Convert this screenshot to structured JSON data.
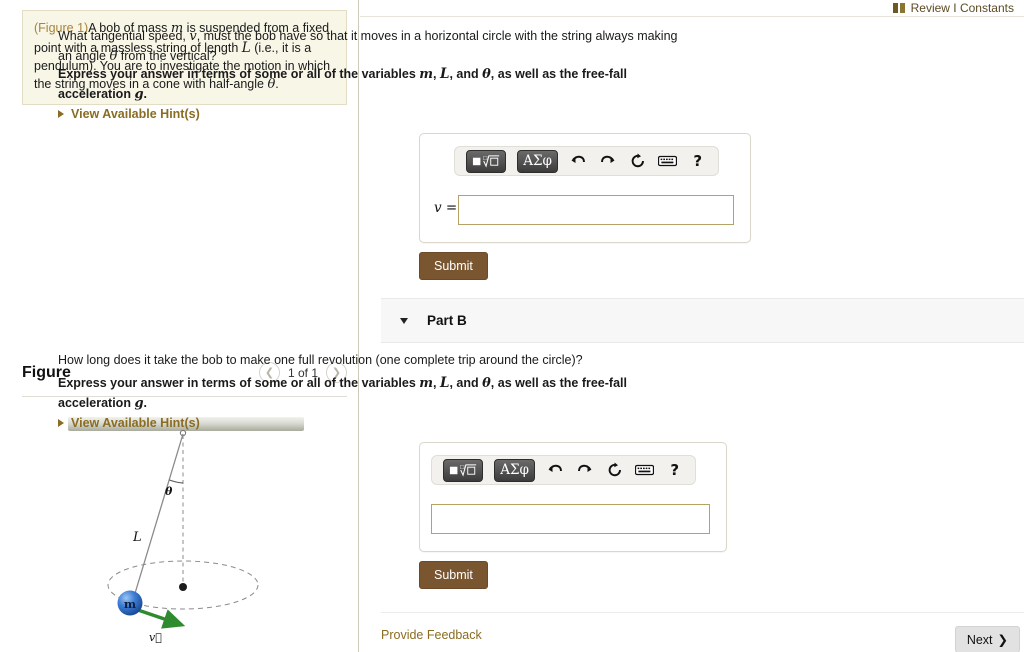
{
  "review": {
    "label": "Review I Constants",
    "icon": "book-icon"
  },
  "problem": {
    "figure_ref": "(Figure 1)",
    "text_1": "A bob of mass ",
    "var_m": "m",
    "text_2": " is suspended from a fixed point with a massless string of length ",
    "var_L": "L",
    "text_3": " (i.e., it is a pendulum). You are to investigate the motion in which the string moves in a cone with half-angle ",
    "var_theta": "θ",
    "text_4": "."
  },
  "figure_panel": {
    "title": "Figure",
    "prev_icon": "chevron-left-icon",
    "next_icon": "chevron-right-icon",
    "count": "1 of 1",
    "labels": {
      "mass": "m",
      "length": "L",
      "angle": "θ",
      "velocity": "v"
    }
  },
  "part_a": {
    "question": "What tangential speed, ",
    "question_var": "v",
    "question_cont": ", must the bob have so that it moves in a horizontal circle with the string always making an angle ",
    "question_var2": "θ",
    "question_end": " from the vertical?",
    "instruction_pre": "Express your answer in terms of some or all of the variables ",
    "instruction_m": "m",
    "instruction_sep1": ", ",
    "instruction_L": "L",
    "instruction_sep2": ", and ",
    "instruction_theta": "θ",
    "instruction_post": ", as well as the free-fall acceleration ",
    "instruction_g": "g",
    "instruction_end": ".",
    "hint_label": "View Available Hint(s)",
    "answer_label": "v =",
    "answer_value": "",
    "submit_label": "Submit",
    "toolbar": {
      "template_icon": "math-template-icon",
      "greek_label": "ΑΣφ",
      "undo_icon": "undo-icon",
      "redo_icon": "redo-icon",
      "reset_icon": "reset-icon",
      "keyboard_icon": "keyboard-icon",
      "help_label": "?"
    }
  },
  "part_b": {
    "collapse_icon": "triangle-down-icon",
    "title": "Part B",
    "question": "How long does it take the bob to make one full revolution (one complete trip around the circle)?",
    "instruction_pre": "Express your answer in terms of some or all of the variables ",
    "instruction_m": "m",
    "instruction_sep1": ", ",
    "instruction_L": "L",
    "instruction_sep2": ", and ",
    "instruction_theta": "θ",
    "instruction_post": ", as well as the free-fall acceleration ",
    "instruction_g": "g",
    "instruction_end": ".",
    "hint_label": "View Available Hint(s)",
    "answer_value": "",
    "submit_label": "Submit",
    "toolbar": {
      "template_icon": "math-template-icon",
      "greek_label": "ΑΣφ",
      "undo_icon": "undo-icon",
      "redo_icon": "redo-icon",
      "reset_icon": "reset-icon",
      "keyboard_icon": "keyboard-icon",
      "help_label": "?"
    }
  },
  "footer": {
    "feedback_label": "Provide Feedback",
    "next_label": "Next",
    "next_icon": "chevron-right-icon"
  },
  "colors": {
    "accent_brown": "#8a6d22",
    "submit_brown": "#7a5630",
    "problem_bg": "#f7f6e7",
    "input_border": "#b5a267",
    "mass_blue": "#2f6fd0",
    "velocity_green": "#2e8b2e"
  }
}
